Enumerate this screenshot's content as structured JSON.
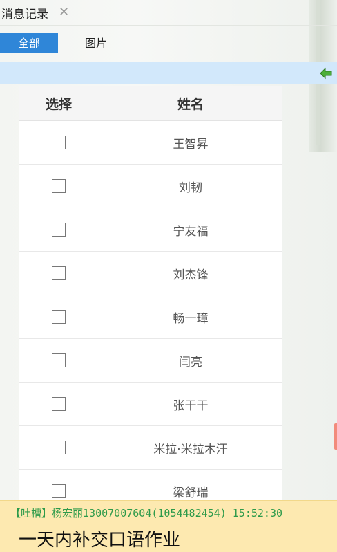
{
  "window": {
    "title": "消息记录"
  },
  "tabs": [
    {
      "label": "全部",
      "active": true
    },
    {
      "label": "图片",
      "active": false
    }
  ],
  "table": {
    "headers": {
      "select": "选择",
      "name": "姓名"
    },
    "rows": [
      {
        "name": "王智昇",
        "checked": false
      },
      {
        "name": "刘韧",
        "checked": false
      },
      {
        "name": "宁友福",
        "checked": false
      },
      {
        "name": "刘杰锋",
        "checked": false
      },
      {
        "name": "畅一璋",
        "checked": false
      },
      {
        "name": "闫亮",
        "checked": false
      },
      {
        "name": "张干干",
        "checked": false
      },
      {
        "name": "米拉·米拉木汗",
        "checked": false
      },
      {
        "name": "梁舒瑞",
        "checked": false
      }
    ]
  },
  "message": {
    "tag": "【吐槽】",
    "sender": "杨宏丽",
    "meta": "13007007604(1054482454) 15:52:30",
    "text": "一天内补交口语作业"
  },
  "colors": {
    "accent": "#2f86d8",
    "bar": "#d2e8fb",
    "message_bg": "#fde9b0",
    "sender_green": "#2d9a4a"
  }
}
